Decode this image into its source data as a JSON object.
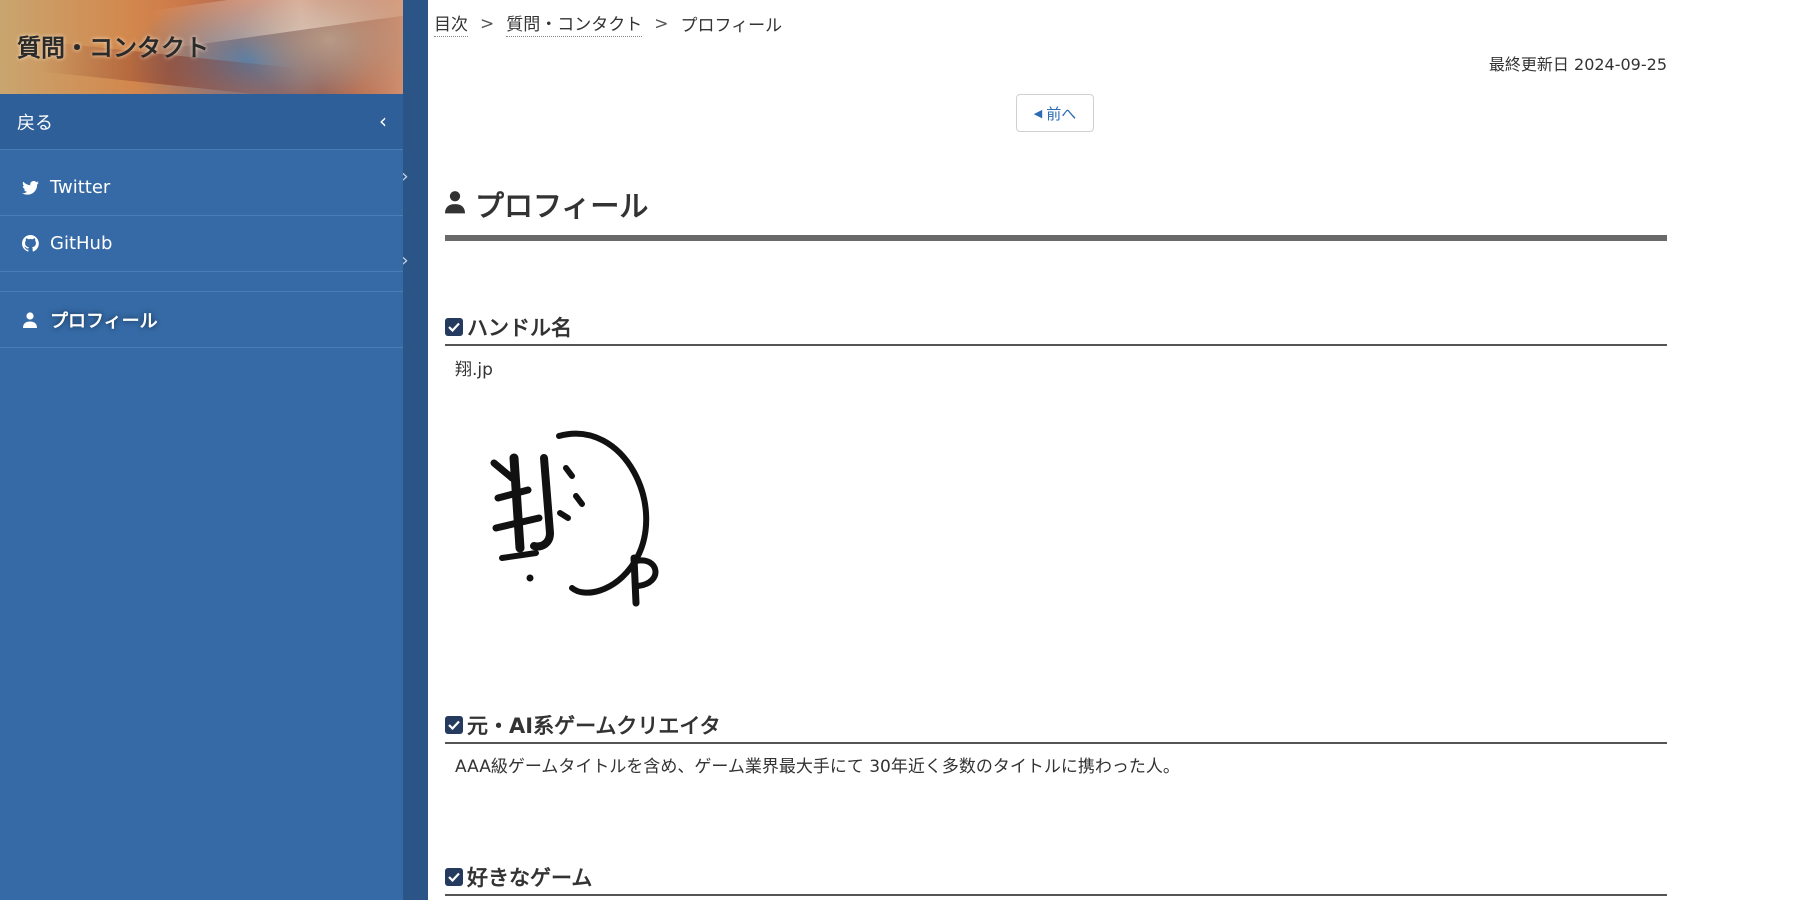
{
  "sidebar": {
    "header_title": "質問・コンタクト",
    "back_label": "戻る",
    "items": [
      {
        "label": "Twitter",
        "icon": "twitter-icon"
      },
      {
        "label": "GitHub",
        "icon": "github-icon"
      },
      {
        "label": "",
        "icon": ""
      },
      {
        "label": "プロフィール",
        "icon": "user-icon",
        "active": true
      }
    ],
    "colors": {
      "background": "#356aa6",
      "rail": "#2a5586"
    }
  },
  "breadcrumb": {
    "items": [
      "目次",
      "質問・コンタクト",
      "プロフィール"
    ],
    "separator": ">"
  },
  "last_updated": "最終更新日 2024-09-25",
  "nav": {
    "prev_label": "前へ"
  },
  "page": {
    "title": "プロフィール",
    "sections": [
      {
        "title": "ハンドル名",
        "text": "翔.jp",
        "image_text": "翔 jp"
      },
      {
        "title": "元・AI系ゲームクリエイタ",
        "text": "AAA級ゲームタイトルを含め、ゲーム業界最大手にて 30年近く多数のタイトルに携わった人。"
      },
      {
        "title": "好きなゲーム",
        "text": ""
      }
    ]
  }
}
